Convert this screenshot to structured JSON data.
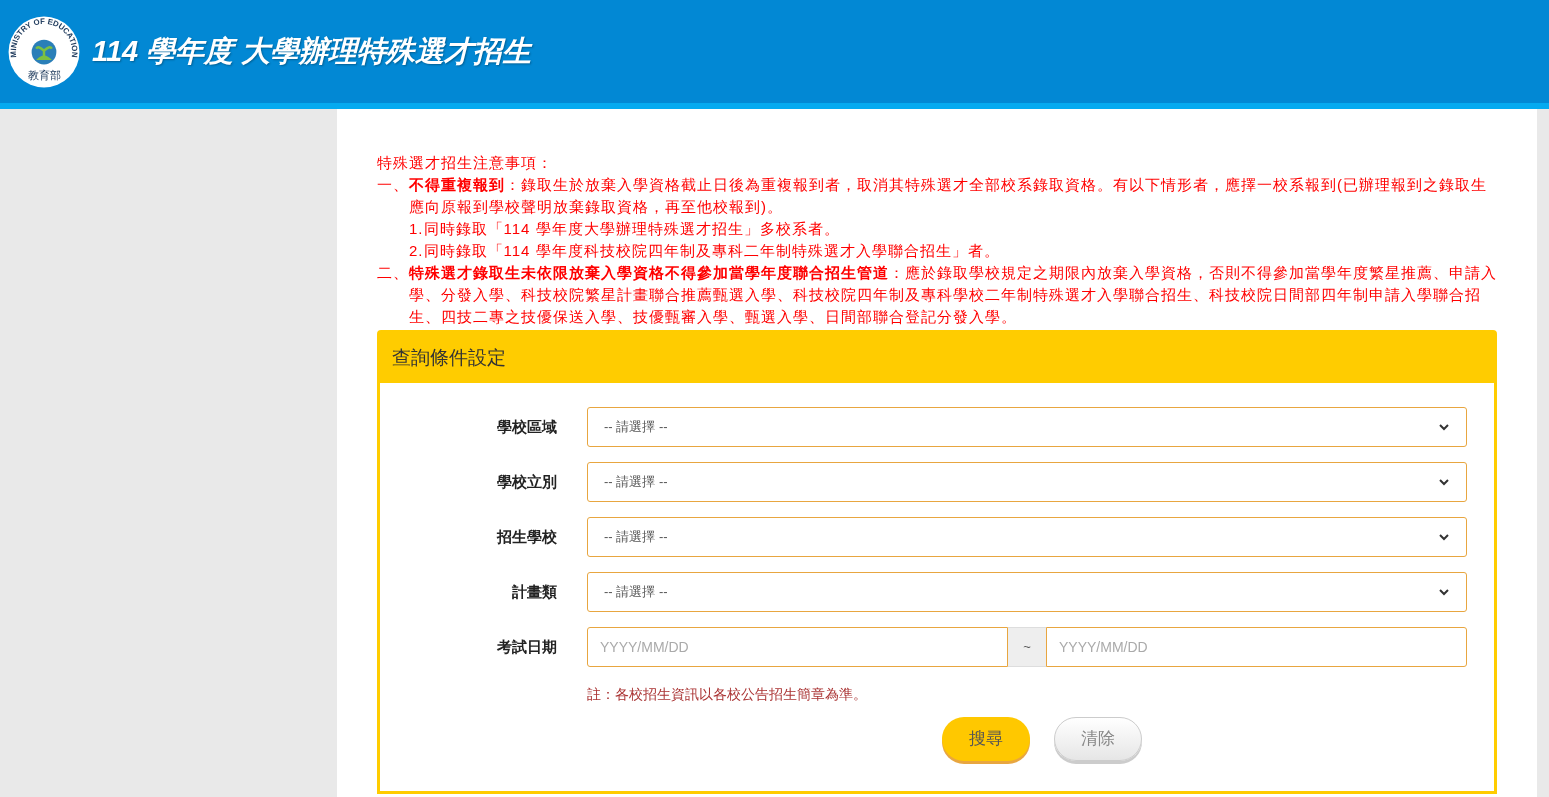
{
  "header": {
    "logo_ring_text": "MINISTRY OF EDUCATION",
    "logo_name": "教育部",
    "title": "114 學年度 大學辦理特殊選才招生"
  },
  "notice": {
    "heading": "特殊選才招生注意事項：",
    "items": [
      {
        "marker": "一、",
        "text": "**不得重複報到**：錄取生於放棄入學資格截止日後為重複報到者，取消其特殊選才全部校系錄取資格。有以下情形者，應擇一校系報到(已辦理報到之錄取生應向原報到學校聲明放棄錄取資格，再至他校報到)。",
        "children": [
          "1.同時錄取「114 學年度大學辦理特殊選才招生」多校系者。",
          "2.同時錄取「114 學年度科技校院四年制及專科二年制特殊選才入學聯合招生」者。"
        ]
      },
      {
        "marker": "二、",
        "text": "**特殊選才錄取生未依限放棄入學資格不得參加當學年度聯合招生管道**：應於錄取學校規定之期限內放棄入學資格，否則不得參加當學年度繁星推薦、申請入學、分發入學、科技校院繁星計畫聯合推薦甄選入學、科技校院四年制及專科學校二年制特殊選才入學聯合招生、科技校院日間部四年制申請入學聯合招生、四技二專之技優保送入學、技優甄審入學、甄選入學、日間部聯合登記分發入學。"
      }
    ]
  },
  "query_panel": {
    "title": "查詢條件設定",
    "fields": [
      {
        "kind": "select",
        "label": "學校區域",
        "value": "-- 請選擇 --"
      },
      {
        "kind": "select",
        "label": "學校立別",
        "value": "-- 請選擇 --"
      },
      {
        "kind": "select",
        "label": "招生學校",
        "value": "-- 請選擇 --"
      },
      {
        "kind": "select",
        "label": "計畫類",
        "value": "-- 請選擇 --"
      },
      {
        "kind": "date_range",
        "label": "考試日期",
        "from_placeholder": "YYYY/MM/DD",
        "separator": "~",
        "to_placeholder": "YYYY/MM/DD"
      }
    ],
    "note": "註：各校招生資訊以各校公告招生簡章為準。",
    "buttons": [
      {
        "kind": "primary",
        "label": "搜尋"
      },
      {
        "kind": "secondary",
        "label": "清除"
      }
    ]
  }
}
